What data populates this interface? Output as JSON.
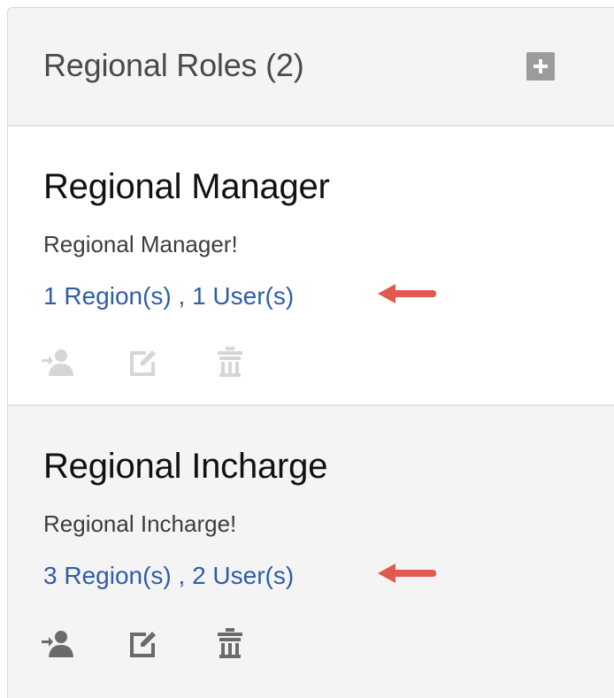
{
  "header": {
    "title": "Regional Roles (2)",
    "add_icon": "plus-icon"
  },
  "roles": [
    {
      "name": "Regional Manager",
      "description": "Regional Manager!",
      "summary": "1 Region(s) , 1 User(s)",
      "icon_state": "disabled"
    },
    {
      "name": "Regional Incharge",
      "description": "Regional Incharge!",
      "summary": "3 Region(s) , 2 User(s)",
      "icon_state": "enabled"
    }
  ],
  "actions": [
    "assign-user-icon",
    "edit-icon",
    "trash-icon"
  ],
  "colors": {
    "link": "#2f5da8",
    "arrow": "#e05a4e",
    "icon_disabled": "#d6d6d6",
    "icon_enabled": "#6b6b6b"
  }
}
